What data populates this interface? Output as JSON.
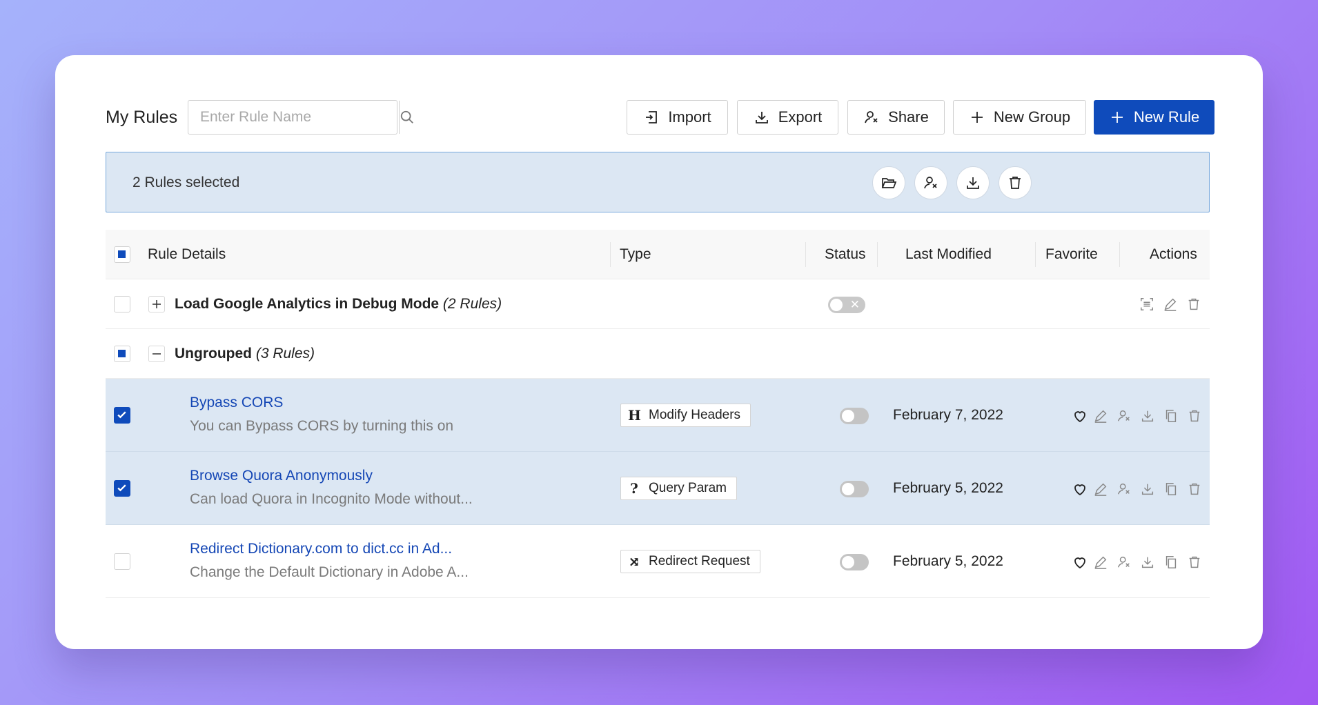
{
  "header": {
    "title": "My Rules",
    "search_placeholder": "Enter Rule Name",
    "buttons": {
      "import": "Import",
      "export": "Export",
      "share": "Share",
      "new_group": "New Group",
      "new_rule": "New Rule"
    }
  },
  "selection_bar": {
    "text": "2 Rules selected",
    "actions": [
      "folder-open-icon",
      "share-user-icon",
      "download-icon",
      "trash-icon"
    ]
  },
  "table": {
    "columns": {
      "details": "Rule Details",
      "type": "Type",
      "status": "Status",
      "last_modified": "Last Modified",
      "favorite": "Favorite",
      "actions": "Actions"
    },
    "groups": [
      {
        "name": "Load Google Analytics in Debug Mode",
        "count": "(2 Rules)",
        "expanded": false,
        "checked": false
      },
      {
        "name": "Ungrouped",
        "count": "(3 Rules)",
        "expanded": true,
        "checked": "indeterminate"
      }
    ],
    "rules": [
      {
        "name": "Bypass CORS",
        "description": "You can Bypass CORS by turning this on",
        "type": "Modify Headers",
        "type_icon": "H",
        "date": "February 7, 2022",
        "checked": true
      },
      {
        "name": "Browse Quora Anonymously",
        "description": "Can load Quora in Incognito Mode without...",
        "type": "Query Param",
        "type_icon": "?",
        "date": "February 5, 2022",
        "checked": true
      },
      {
        "name": "Redirect Dictionary.com to dict.cc in Ad...",
        "description": "Change the Default Dictionary in Adobe A...",
        "type": "Redirect Request",
        "type_icon": "⤨",
        "date": "February 5, 2022",
        "checked": false
      }
    ]
  },
  "colors": {
    "primary": "#0f4bbb",
    "link": "#1547b5",
    "selected_row": "#dce7f3",
    "selection_border": "#76a7dc"
  }
}
